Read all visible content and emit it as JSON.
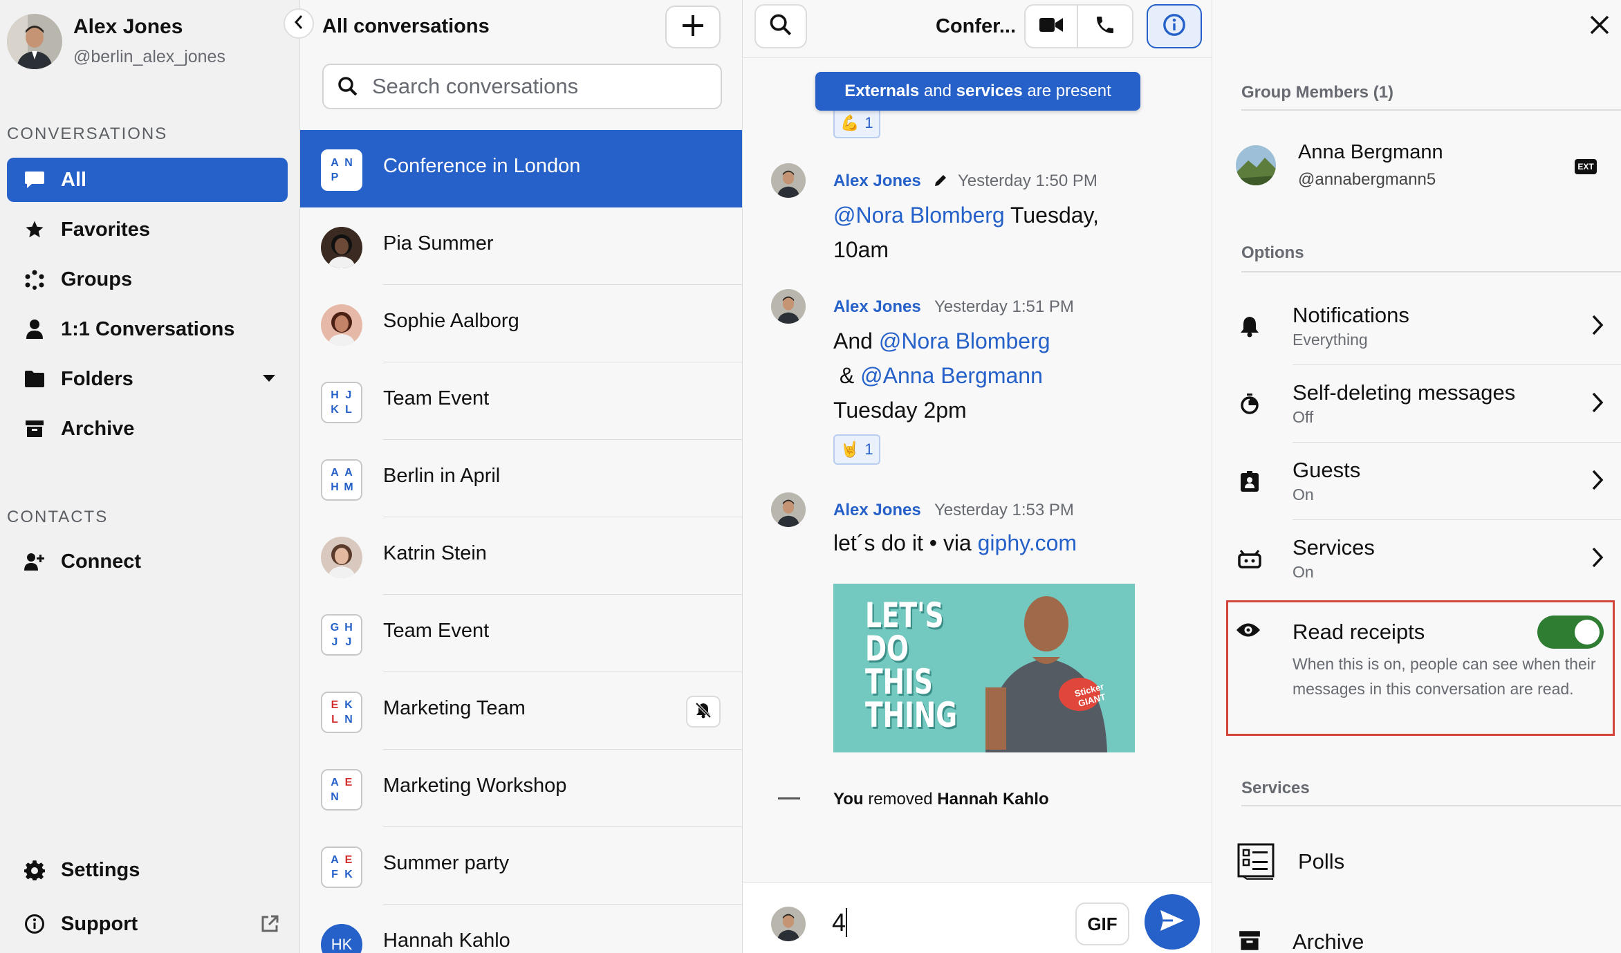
{
  "user": {
    "name": "Alex Jones",
    "handle": "@berlin_alex_jones"
  },
  "sidebar": {
    "conversations_title": "CONVERSATIONS",
    "nav": [
      {
        "label": "All",
        "icon": "chat-bubble-icon",
        "active": true
      },
      {
        "label": "Favorites",
        "icon": "star-icon"
      },
      {
        "label": "Groups",
        "icon": "groups-icon"
      },
      {
        "label": "1:1 Conversations",
        "icon": "person-icon"
      },
      {
        "label": "Folders",
        "icon": "folder-icon"
      },
      {
        "label": "Archive",
        "icon": "archive-icon"
      }
    ],
    "contacts_title": "CONTACTS",
    "connect_label": "Connect",
    "settings_label": "Settings",
    "support_label": "Support"
  },
  "list": {
    "title": "All conversations",
    "search_placeholder": "Search conversations",
    "conversations": [
      {
        "name": "Conference in London",
        "type": "group",
        "letters": [
          [
            "A",
            "#2561c9"
          ],
          [
            "N",
            "#2561c9"
          ],
          [
            "P",
            "#2561c9"
          ]
        ],
        "active": true
      },
      {
        "name": "Pia Summer",
        "type": "person"
      },
      {
        "name": "Sophie Aalborg",
        "type": "person"
      },
      {
        "name": "Team Event",
        "type": "group",
        "letters": [
          [
            "H",
            "#2561c9"
          ],
          [
            "J",
            "#2561c9"
          ],
          [
            "K",
            "#2561c9"
          ],
          [
            "L",
            "#2561c9"
          ]
        ]
      },
      {
        "name": "Berlin in April",
        "type": "group",
        "letters": [
          [
            "A",
            "#2561c9"
          ],
          [
            "A",
            "#2561c9"
          ],
          [
            "H",
            "#2561c9"
          ],
          [
            "M",
            "#2561c9"
          ]
        ]
      },
      {
        "name": "Katrin Stein",
        "type": "person"
      },
      {
        "name": "Team Event",
        "type": "group",
        "letters": [
          [
            "G",
            "#2561c9"
          ],
          [
            "H",
            "#2561c9"
          ],
          [
            "J",
            "#2561c9"
          ],
          [
            "J",
            "#2561c9"
          ]
        ]
      },
      {
        "name": "Marketing Team",
        "type": "group",
        "letters": [
          [
            "E",
            "#d32f2f"
          ],
          [
            "K",
            "#2561c9"
          ],
          [
            "L",
            "#d32f2f"
          ],
          [
            "N",
            "#2561c9"
          ]
        ],
        "muted": true
      },
      {
        "name": "Marketing Workshop",
        "type": "group",
        "letters": [
          [
            "A",
            "#2561c9"
          ],
          [
            "E",
            "#d32f2f"
          ],
          [
            "N",
            "#2561c9"
          ]
        ]
      },
      {
        "name": "Summer party",
        "type": "group",
        "letters": [
          [
            "A",
            "#2561c9"
          ],
          [
            "E",
            "#d32f2f"
          ],
          [
            "F",
            "#2561c9"
          ],
          [
            "K",
            "#2561c9"
          ]
        ]
      },
      {
        "name": "Hannah Kahlo",
        "type": "initials",
        "initials": "HK"
      }
    ]
  },
  "chat": {
    "title": "Confer...",
    "banner": {
      "externals": "Externals",
      "and": " and ",
      "services": "services",
      "present": " are present"
    },
    "top_reaction": {
      "emoji": "💪",
      "count": "1"
    },
    "messages": [
      {
        "author": "Alex Jones",
        "edited": true,
        "time": "Yesterday 1:50 PM",
        "mention1": "@Nora Blomberg",
        "text1": " Tuesday, 10am"
      },
      {
        "author": "Alex Jones",
        "time": "Yesterday 1:51 PM",
        "prefix": "And ",
        "mention1": "@Nora Blomberg",
        "mid": " & ",
        "mention2": "@Anna Bergmann",
        "suffix": " Tuesday 2pm",
        "reaction_emoji": "🤘",
        "reaction_count": "1"
      },
      {
        "author": "Alex Jones",
        "time": "Yesterday 1:53 PM",
        "text": "let´s do it • via ",
        "link": "giphy.com"
      }
    ],
    "gif_text": [
      "LET'S",
      "DO",
      "THIS",
      "THING"
    ],
    "gif_sticker": "Sticker GIANT",
    "system": {
      "you": "You",
      "removed": " removed ",
      "who": "Hannah Kahlo"
    },
    "composer_value": "4",
    "gif_button": "GIF"
  },
  "details": {
    "members_title": "Group Members (1)",
    "member": {
      "name": "Anna Bergmann",
      "handle": "@annabergmann5",
      "badge": "EXT"
    },
    "options_title": "Options",
    "options": [
      {
        "title": "Notifications",
        "sub": "Everything",
        "icon": "bell-icon"
      },
      {
        "title": "Self-deleting messages",
        "sub": "Off",
        "icon": "timer-icon"
      },
      {
        "title": "Guests",
        "sub": "On",
        "icon": "guest-badge-icon"
      },
      {
        "title": "Services",
        "sub": "On",
        "icon": "bot-icon"
      }
    ],
    "read_receipts": {
      "title": "Read receipts",
      "desc": "When this is on, people can see when their messages in this conversation are read.",
      "on": true
    },
    "services_title": "Services",
    "services": [
      {
        "title": "Polls"
      },
      {
        "title": "Archive"
      }
    ]
  },
  "colors": {
    "accent": "#2561c9",
    "toggle_on": "#2e7d32",
    "highlight_border": "#d5443b"
  }
}
